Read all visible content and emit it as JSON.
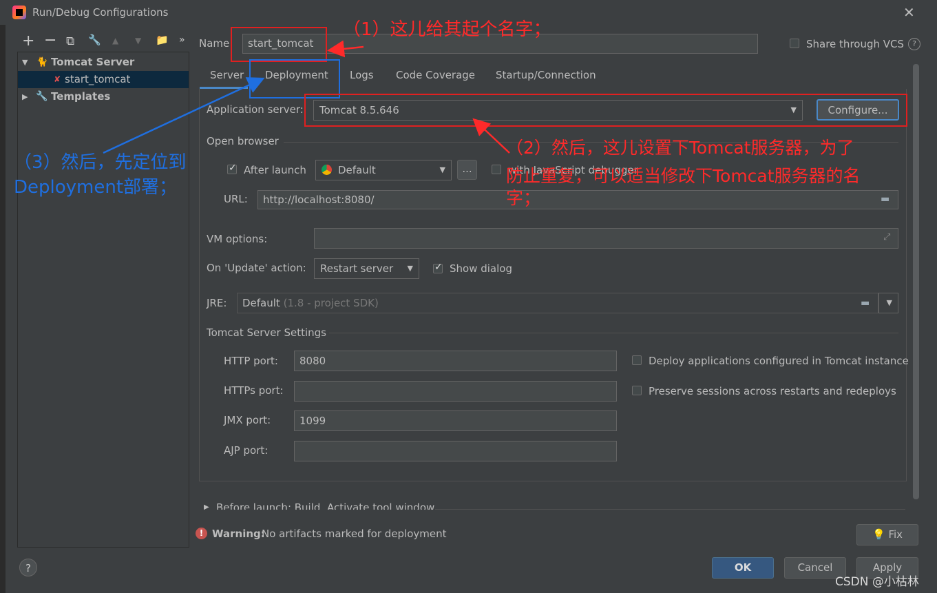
{
  "window": {
    "title": "Run/Debug Configurations"
  },
  "toolbar": {
    "add": "+",
    "remove": "−",
    "copy": "⧉",
    "wrench": "🔧",
    "up": "▲",
    "down": "▼",
    "folder": "📁",
    "more": "»"
  },
  "tree": {
    "group": "Tomcat Server",
    "child": "start_tomcat",
    "templates": "Templates"
  },
  "form": {
    "name_label": "Name:",
    "name_value": "start_tomcat",
    "share_label": "Share through VCS",
    "help_glyph": "?"
  },
  "tabs": [
    "Server",
    "Deployment",
    "Logs",
    "Code Coverage",
    "Startup/Connection"
  ],
  "server": {
    "app_server_label": "Application server:",
    "app_server_value": "Tomcat 8.5.646",
    "configure_label": "Configure...",
    "open_browser_label": "Open browser",
    "after_launch_label": "After launch",
    "browser_value": "Default",
    "ellipsis": "...",
    "js_debugger_label": "with JavaScript debugger",
    "url_label": "URL:",
    "url_value": "http://localhost:8080/",
    "vm_label": "VM options:",
    "update_label": "On 'Update' action:",
    "update_value": "Restart server",
    "show_dialog_label": "Show dialog",
    "jre_label": "JRE:",
    "jre_value": "Default",
    "jre_hint": "(1.8 - project SDK)",
    "tomcat_settings_label": "Tomcat Server Settings",
    "http_port_label": "HTTP port:",
    "http_port_value": "8080",
    "https_port_label": "HTTPs port:",
    "https_port_value": "",
    "jmx_port_label": "JMX port:",
    "jmx_port_value": "1099",
    "ajp_port_label": "AJP port:",
    "ajp_port_value": "",
    "deploy_configured_label": "Deploy applications configured in Tomcat instance",
    "preserve_sessions_label": "Preserve sessions across restarts and redeploys"
  },
  "before_launch": "Before launch: Build, Activate tool window",
  "warning": {
    "title": "Warning:",
    "text": "No artifacts marked for deployment"
  },
  "buttons": {
    "fix": "Fix",
    "ok": "OK",
    "cancel": "Cancel",
    "apply": "Apply"
  },
  "annotations": {
    "note1": "（1）这儿给其起个名字；",
    "note2_line1": "（2）然后，这儿设置下Tomcat服务器，为了",
    "note2_line2": "防止重复，可以适当修改下Tomcat服务器的名",
    "note2_line3": "字；",
    "note3_line1": "（3）然后，先定位到",
    "note3_line2": "Deployment部署；"
  },
  "watermark": "CSDN @小枯林",
  "colors": {
    "annotation_red": "#ff2a2a",
    "annotation_blue": "#1f6fe0",
    "selection": "#0d293e",
    "primary_button": "#365880",
    "tab_underline": "#4a88c7"
  }
}
